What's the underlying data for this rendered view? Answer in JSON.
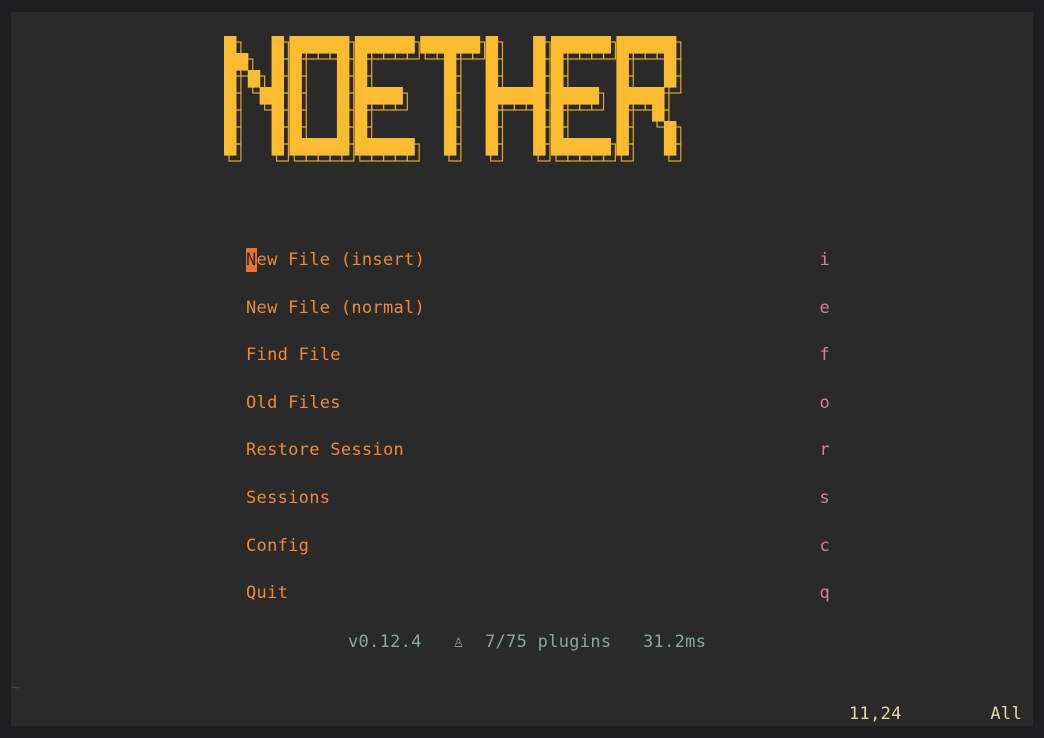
{
  "colors": {
    "background": "#2a2a2a",
    "outer_background": "#1d1e20",
    "banner_fill": "#fbbc2f",
    "banner_outline": "#e4a82a",
    "menu_label": "#ee8a38",
    "cursor_bg": "#e8742b",
    "shortcut_key": "#d4829a",
    "footer_text": "#87a99a",
    "status_text": "#e8d9a4",
    "tilde": "#4a4a4a"
  },
  "banner": {
    "title": "NOETHER"
  },
  "menu": {
    "items": [
      {
        "cursor_char": "N",
        "rest": "ew File (insert)",
        "key": "i",
        "icon": "none"
      },
      {
        "label": "New File (normal)",
        "key": "e"
      },
      {
        "label": "Find File",
        "key": "f"
      },
      {
        "label": "Old Files",
        "key": "o"
      },
      {
        "label": "Restore Session",
        "key": "r"
      },
      {
        "label": "Sessions",
        "key": "s"
      },
      {
        "label": "Config",
        "key": "c"
      },
      {
        "label": "Quit",
        "key": "q"
      }
    ]
  },
  "footer": {
    "version": "v0.12.4",
    "plugin_icon": "flask-icon",
    "plugin_glyph": "♙",
    "plugins": "7/75 plugins",
    "startup_time": "31.2ms"
  },
  "buffer": {
    "tilde": "~"
  },
  "statusline": {
    "cursor_position": "11,24",
    "scroll": "All"
  }
}
